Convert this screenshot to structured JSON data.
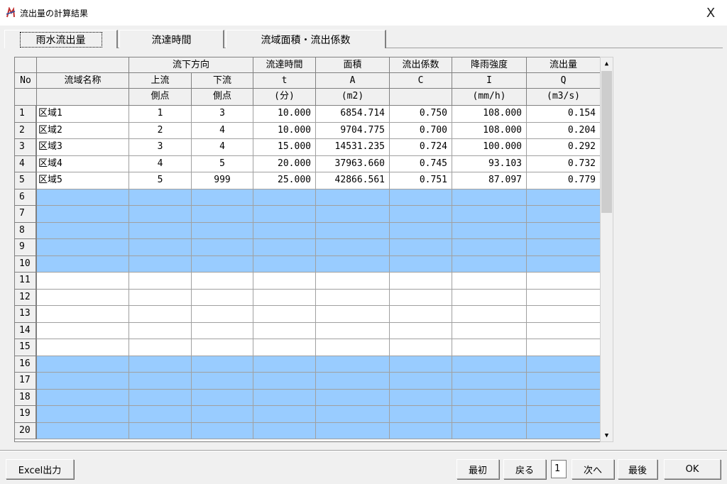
{
  "window": {
    "title": "流出量の計算結果",
    "close_label": "X"
  },
  "tabs": [
    {
      "label": "雨水流出量",
      "active": true
    },
    {
      "label": "流達時間",
      "active": false
    },
    {
      "label": "流域面積・流出係数",
      "active": false
    }
  ],
  "table": {
    "headers": {
      "no": "No",
      "name": "流域名称",
      "flow_dir": "流下方向",
      "upstream": "上流",
      "downstream": "下流",
      "node": "側点",
      "time": "流達時間",
      "time_sym": "t",
      "time_unit": "(分)",
      "area": "面積",
      "area_sym": "A",
      "area_unit": "(m2)",
      "coef": "流出係数",
      "coef_sym": "C",
      "rain": "降雨強度",
      "rain_sym": "I",
      "rain_unit": "(mm/h)",
      "flow": "流出量",
      "flow_sym": "Q",
      "flow_unit": "(m3/s)"
    },
    "rows": [
      {
        "no": "1",
        "name": "区域1",
        "up": "1",
        "down": "3",
        "t": "10.000",
        "a": "6854.714",
        "c": "0.750",
        "i": "108.000",
        "q": "0.154"
      },
      {
        "no": "2",
        "name": "区域2",
        "up": "2",
        "down": "4",
        "t": "10.000",
        "a": "9704.775",
        "c": "0.700",
        "i": "108.000",
        "q": "0.204"
      },
      {
        "no": "3",
        "name": "区域3",
        "up": "3",
        "down": "4",
        "t": "15.000",
        "a": "14531.235",
        "c": "0.724",
        "i": "100.000",
        "q": "0.292"
      },
      {
        "no": "4",
        "name": "区域4",
        "up": "4",
        "down": "5",
        "t": "20.000",
        "a": "37963.660",
        "c": "0.745",
        "i": "93.103",
        "q": "0.732"
      },
      {
        "no": "5",
        "name": "区域5",
        "up": "5",
        "down": "999",
        "t": "25.000",
        "a": "42866.561",
        "c": "0.751",
        "i": "87.097",
        "q": "0.779"
      },
      {
        "no": "6"
      },
      {
        "no": "7"
      },
      {
        "no": "8"
      },
      {
        "no": "9"
      },
      {
        "no": "10"
      },
      {
        "no": "11"
      },
      {
        "no": "12"
      },
      {
        "no": "13"
      },
      {
        "no": "14"
      },
      {
        "no": "15"
      },
      {
        "no": "16"
      },
      {
        "no": "17"
      },
      {
        "no": "18"
      },
      {
        "no": "19"
      },
      {
        "no": "20"
      }
    ],
    "highlight_color": "#99ccff"
  },
  "footer": {
    "excel_label": "Excel出力",
    "first_label": "最初",
    "back_label": "戻る",
    "page_value": "1",
    "next_label": "次へ",
    "last_label": "最後",
    "ok_label": "OK"
  }
}
